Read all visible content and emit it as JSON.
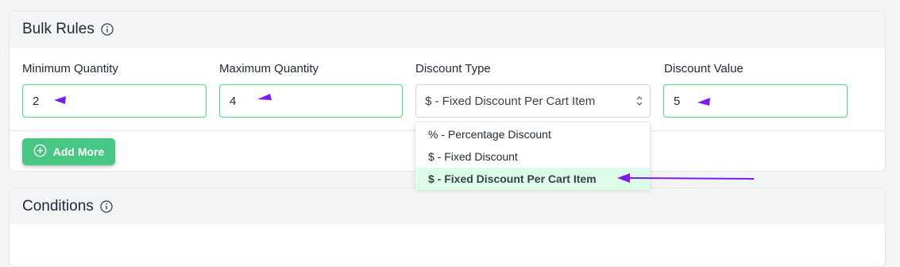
{
  "bulk_rules": {
    "title": "Bulk Rules",
    "fields": {
      "min_qty_label": "Minimum Quantity",
      "min_qty_value": "2",
      "max_qty_label": "Maximum Quantity",
      "max_qty_value": "4",
      "discount_type_label": "Discount Type",
      "discount_type_value": "$ - Fixed Discount Per Cart Item",
      "discount_value_label": "Discount Value",
      "discount_value_value": "5"
    },
    "add_more_label": "Add More",
    "dropdown_options": [
      "% - Percentage Discount",
      "$ - Fixed Discount",
      "$ - Fixed Discount Per Cart Item"
    ]
  },
  "conditions": {
    "title": "Conditions"
  },
  "colors": {
    "accent_green": "#48c784",
    "annotation_purple": "#7c1cf0"
  }
}
